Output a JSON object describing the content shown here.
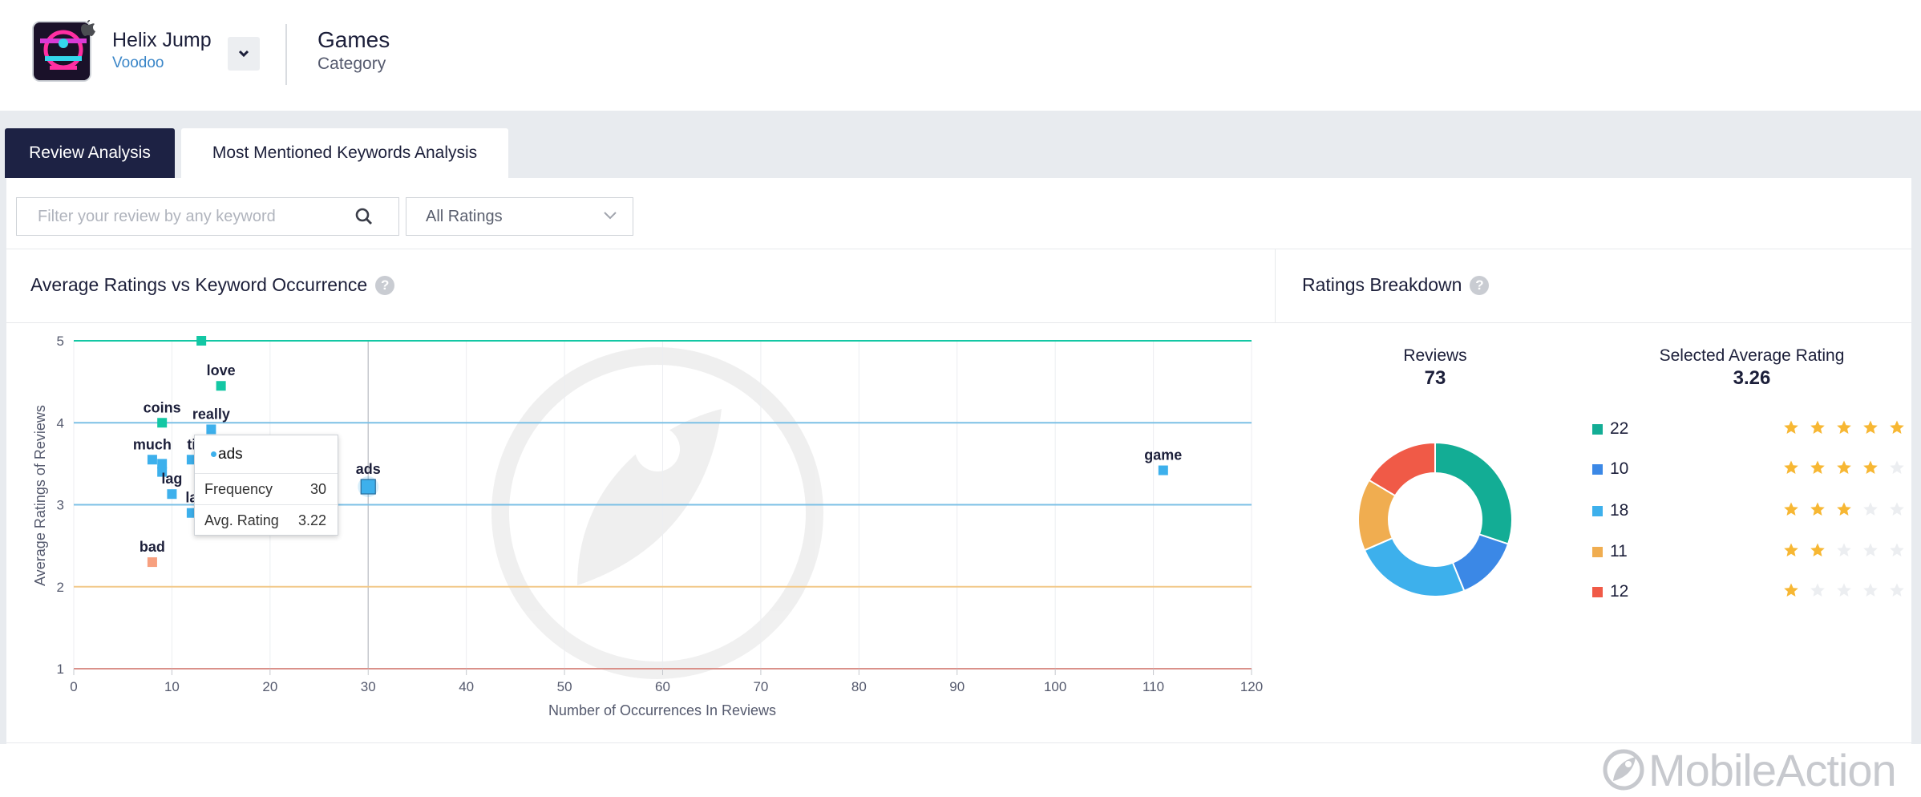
{
  "app": {
    "name": "Helix Jump",
    "developer": "Voodoo",
    "category_value": "Games",
    "category_label": "Category"
  },
  "tabs": [
    {
      "label": "Review Analysis",
      "active": true
    },
    {
      "label": "Most Mentioned Keywords Analysis",
      "active": false
    }
  ],
  "filters": {
    "search_placeholder": "Filter your review by any keyword",
    "ratings_select": "All Ratings"
  },
  "scatter_panel": {
    "title": "Average Ratings vs Keyword Occurrence"
  },
  "breakdown_panel": {
    "title": "Ratings Breakdown",
    "reviews_label": "Reviews",
    "reviews_value": "73",
    "avg_label": "Selected Average Rating",
    "avg_value": "3.26",
    "rows": [
      {
        "count": "22",
        "stars": 5,
        "color": "#13ad95"
      },
      {
        "count": "10",
        "stars": 4,
        "color": "#3b88e6"
      },
      {
        "count": "18",
        "stars": 3,
        "color": "#3db0ec"
      },
      {
        "count": "11",
        "stars": 2,
        "color": "#f0ad50"
      },
      {
        "count": "12",
        "stars": 1,
        "color": "#f05a47"
      }
    ]
  },
  "tooltip": {
    "keyword": "ads",
    "frequency_label": "Frequency",
    "frequency_value": "30",
    "avg_label": "Avg. Rating",
    "avg_value": "3.22"
  },
  "chart_data": {
    "type": "scatter",
    "xlabel": "Number of Occurrences In Reviews",
    "ylabel": "Average Ratings of Reviews",
    "xlim": [
      0,
      120
    ],
    "ylim": [
      1,
      5
    ],
    "xticks": [
      "0",
      "10",
      "20",
      "30",
      "40",
      "50",
      "60",
      "70",
      "80",
      "90",
      "100",
      "110",
      "120"
    ],
    "yticks": [
      "1",
      "2",
      "3",
      "4",
      "5"
    ],
    "grid": true,
    "reference_lines": [
      {
        "y": 5,
        "color": "#13c7a4"
      },
      {
        "y": 4,
        "color": "#7cc0e6"
      },
      {
        "y": 3,
        "color": "#7cc0e6"
      },
      {
        "y": 2,
        "color": "#f2c98a"
      },
      {
        "y": 1,
        "color": "#f05a47"
      }
    ],
    "points": [
      {
        "label": "",
        "x": 13,
        "y": 5.0,
        "color": "#13c7a4"
      },
      {
        "label": "love",
        "x": 15,
        "y": 4.45,
        "color": "#13c7a4"
      },
      {
        "label": "coins",
        "x": 9,
        "y": 4.0,
        "color": "#13c7a4"
      },
      {
        "label": "really",
        "x": 14,
        "y": 3.92,
        "color": "#3db0ec"
      },
      {
        "label": "much",
        "x": 8,
        "y": 3.55,
        "color": "#3db0ec"
      },
      {
        "label": "",
        "x": 9,
        "y": 3.5,
        "color": "#3db0ec"
      },
      {
        "label": "",
        "x": 9,
        "y": 3.4,
        "color": "#3db0ec"
      },
      {
        "label": "ti",
        "x": 12,
        "y": 3.55,
        "color": "#3db0ec"
      },
      {
        "label": "lag",
        "x": 10,
        "y": 3.13,
        "color": "#3db0ec"
      },
      {
        "label": "la",
        "x": 12,
        "y": 2.9,
        "color": "#3db0ec"
      },
      {
        "label": "ads",
        "x": 30,
        "y": 3.22,
        "color": "#3db0ec",
        "highlight": true
      },
      {
        "label": "game",
        "x": 111,
        "y": 3.42,
        "color": "#3db0ec"
      },
      {
        "label": "bad",
        "x": 8,
        "y": 2.3,
        "color": "#f7a07f"
      }
    ]
  },
  "brand": {
    "name": "MobileAction"
  }
}
